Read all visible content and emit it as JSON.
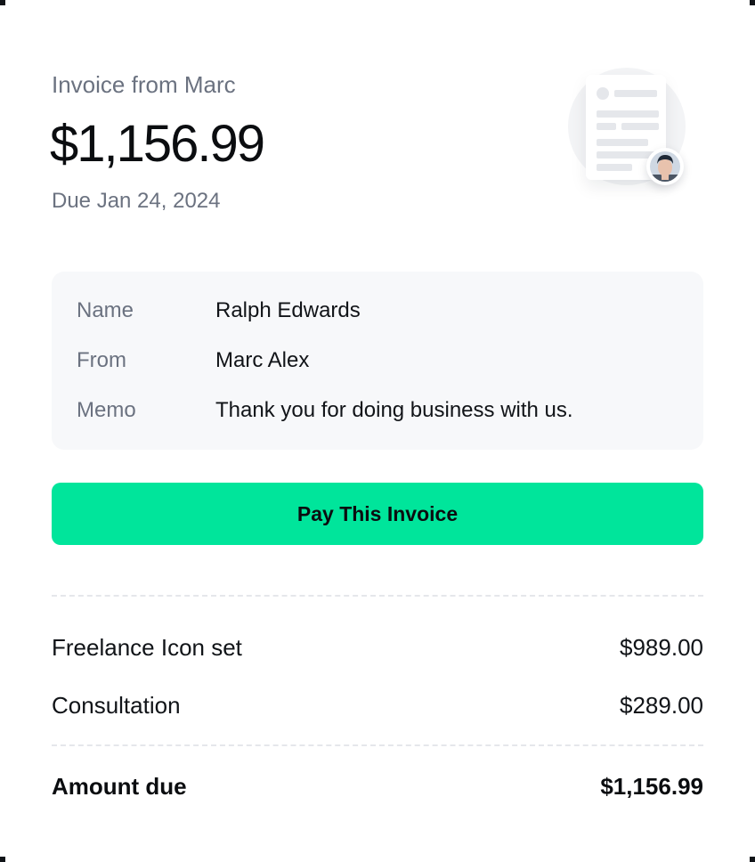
{
  "invoice": {
    "from_title": "Invoice from Marc",
    "amount": "$1,156.99",
    "due": "Due Jan 24, 2024"
  },
  "details": {
    "rows": [
      {
        "label": "Name",
        "value": "Ralph Edwards"
      },
      {
        "label": "From",
        "value": "Marc Alex"
      },
      {
        "label": "Memo",
        "value": "Thank you for doing business with us."
      }
    ]
  },
  "actions": {
    "pay_label": "Pay This Invoice"
  },
  "line_items": [
    {
      "name": "Freelance Icon set",
      "amount": "$989.00"
    },
    {
      "name": "Consultation",
      "amount": "$289.00"
    }
  ],
  "summary": {
    "label": "Amount due",
    "amount": "$1,156.99"
  },
  "colors": {
    "accent": "#00e59b",
    "muted_text": "#6b7280",
    "panel_bg": "#f7f8fa"
  }
}
